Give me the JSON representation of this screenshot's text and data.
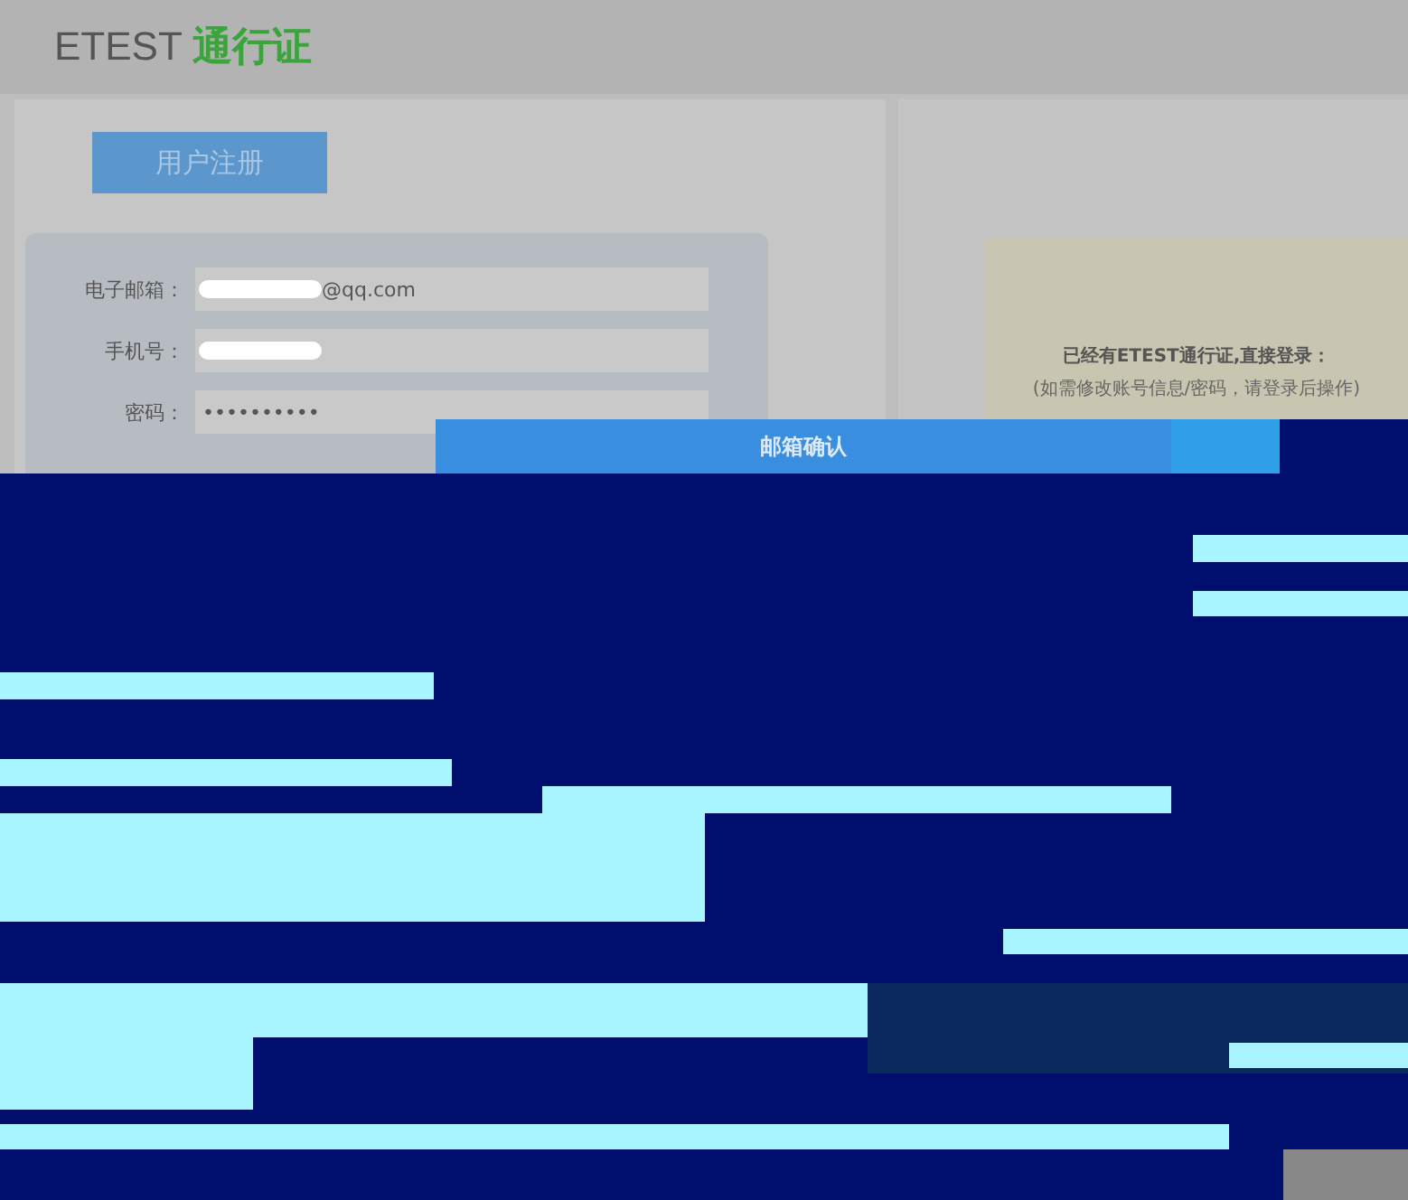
{
  "header": {
    "brand": "ETEST",
    "brand_suffix": "通行证"
  },
  "register_button": "用户注册",
  "form": {
    "fields": [
      {
        "label": "电子邮箱：",
        "value": "@qq.com",
        "redacted": true
      },
      {
        "label": "手机号：",
        "redacted": true
      },
      {
        "label": "密码：",
        "value": "••••••••••",
        "redacted": false
      }
    ]
  },
  "login_panel": {
    "title": "已经有ETEST通行证,直接登录：",
    "note": "(如需修改账号信息/密码，请登录后操作)"
  },
  "dialog": {
    "title": "邮箱确认"
  }
}
